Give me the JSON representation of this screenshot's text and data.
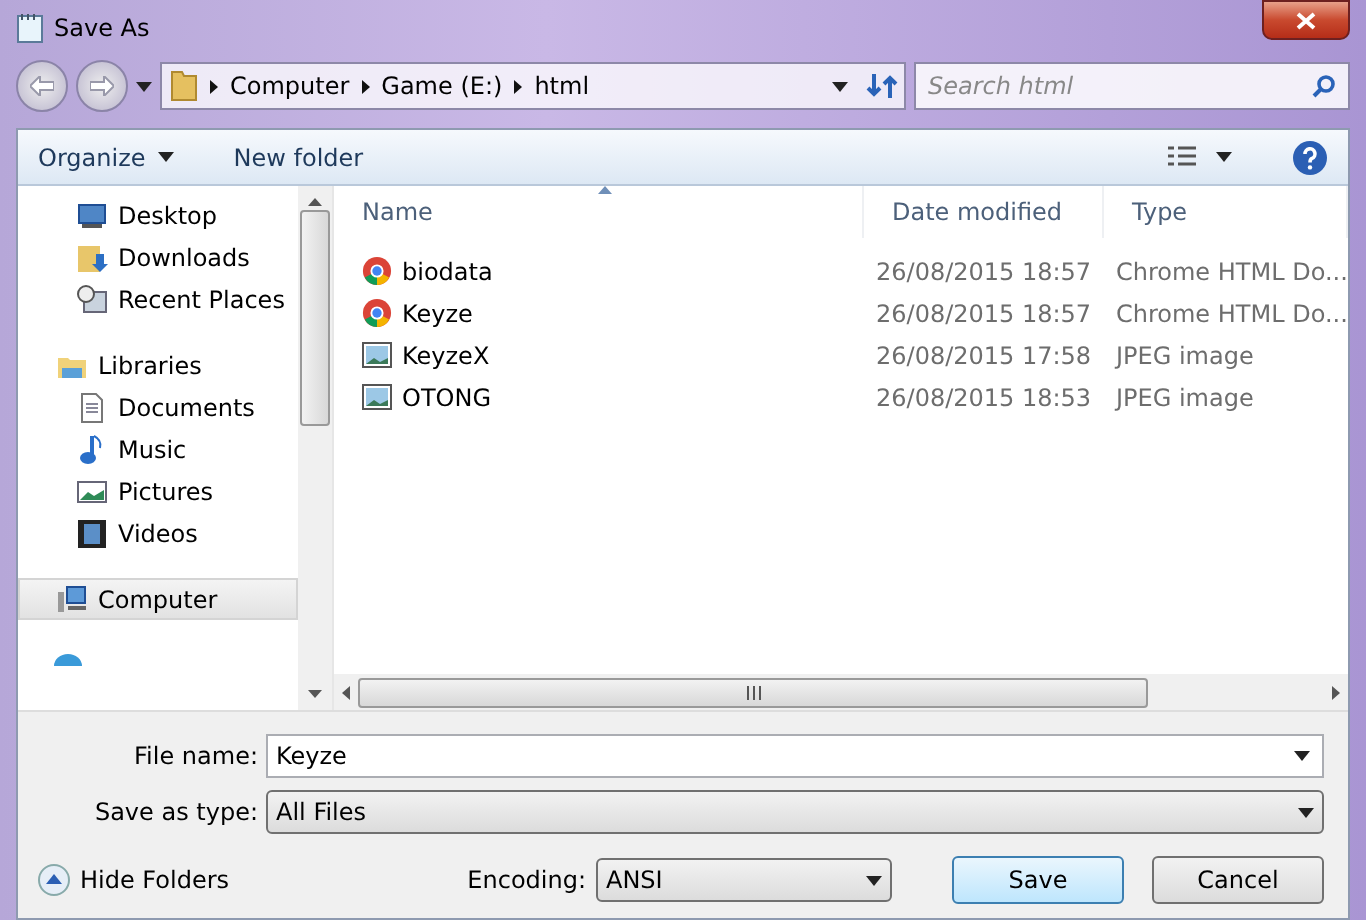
{
  "window": {
    "title": "Save As"
  },
  "address": {
    "crumbs": [
      "Computer",
      "Game (E:)",
      "html"
    ],
    "search_placeholder": "Search html"
  },
  "toolbar": {
    "organize": "Organize",
    "new_folder": "New folder"
  },
  "sidebar": {
    "sections": [
      {
        "items": [
          {
            "label": "Desktop",
            "kind": "desktop",
            "selected": false
          },
          {
            "label": "Downloads",
            "kind": "downloads",
            "selected": false
          },
          {
            "label": "Recent Places",
            "kind": "recent",
            "selected": false
          }
        ]
      },
      {
        "items": [
          {
            "label": "Libraries",
            "kind": "libraries",
            "selected": false,
            "children": [
              {
                "label": "Documents",
                "kind": "documents",
                "selected": false
              },
              {
                "label": "Music",
                "kind": "music",
                "selected": false
              },
              {
                "label": "Pictures",
                "kind": "pictures",
                "selected": false
              },
              {
                "label": "Videos",
                "kind": "videos",
                "selected": false
              }
            ]
          }
        ]
      },
      {
        "items": [
          {
            "label": "Computer",
            "kind": "computer",
            "selected": true
          }
        ]
      }
    ]
  },
  "columns": [
    {
      "label": "Name",
      "sorted": true
    },
    {
      "label": "Date modified",
      "sorted": false
    },
    {
      "label": "Type",
      "sorted": false
    }
  ],
  "files": [
    {
      "name": "biodata",
      "date": "26/08/2015 18:57",
      "type": "Chrome HTML Do...",
      "kind": "html"
    },
    {
      "name": "Keyze",
      "date": "26/08/2015 18:57",
      "type": "Chrome HTML Do...",
      "kind": "html"
    },
    {
      "name": "KeyzeX",
      "date": "26/08/2015 17:58",
      "type": "JPEG image",
      "kind": "image"
    },
    {
      "name": "OTONG",
      "date": "26/08/2015 18:53",
      "type": "JPEG image",
      "kind": "image"
    }
  ],
  "form": {
    "file_name_label": "File name:",
    "file_name": "Keyze",
    "type_label": "Save as type:",
    "type": "All Files"
  },
  "footer": {
    "hide_folders": "Hide Folders",
    "encoding_label": "Encoding:",
    "encoding": "ANSI",
    "save": "Save",
    "cancel": "Cancel"
  }
}
